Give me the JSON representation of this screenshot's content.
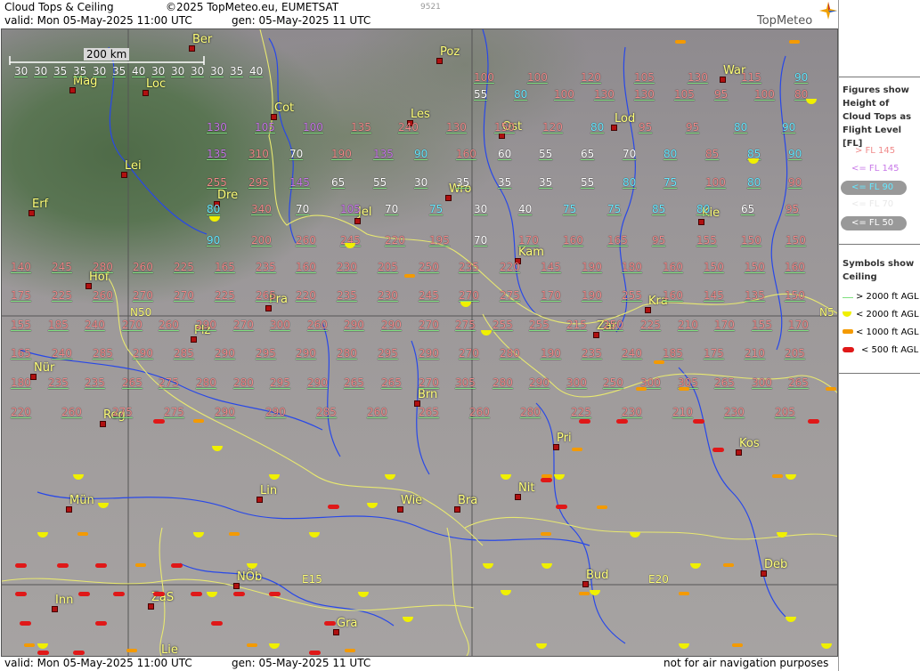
{
  "header": {
    "title": "Cloud Tops & Ceiling",
    "copyright": "©2025 TopMeteo.eu, EUMETSAT",
    "valid": "valid:  Mon  05-May-2025  11:00 UTC",
    "gen": "gen: 05-May-2025 11 UTC",
    "id": "9521",
    "logo": "TopMeteo"
  },
  "footer": {
    "valid": "valid:  Mon  05-May-2025  11:00 UTC",
    "gen": "gen: 05-May-2025 11 UTC",
    "disclaimer": "not for air navigation purposes"
  },
  "scale_label": "200 km",
  "legend": {
    "figures_title": "Figures show Height of Cloud Tops as Flight Level  [FL]",
    "fl_items": [
      {
        "text": "> FL 145",
        "color": "#f08a8a"
      },
      {
        "text": "<= FL 145",
        "color": "#c878e8"
      },
      {
        "text": "<= FL 90",
        "color": "#66e8ff"
      },
      {
        "text": "<= FL 70",
        "color": "#e8e8e8"
      },
      {
        "text": "<= FL 50",
        "color": "#ffffff"
      }
    ],
    "symbols_title": "Symbols show Ceiling",
    "symbol_items": [
      {
        "text": "> 2000 ft AGL",
        "symbol": "green-line"
      },
      {
        "text": "< 2000 ft AGL",
        "symbol": "yellow-half-circle"
      },
      {
        "text": "< 1000 ft AGL",
        "symbol": "orange-bar"
      },
      {
        "text": "< 500 ft AGL",
        "symbol": "red-bar"
      }
    ]
  },
  "grid_labels": [
    "N50",
    "N5",
    "E15",
    "E20"
  ],
  "cities": [
    {
      "name": "Ber"
    },
    {
      "name": "Poz"
    },
    {
      "name": "War"
    },
    {
      "name": "Mag"
    },
    {
      "name": "Loc"
    },
    {
      "name": "Cot"
    },
    {
      "name": "Les"
    },
    {
      "name": "Ost"
    },
    {
      "name": "Lod"
    },
    {
      "name": "Lei"
    },
    {
      "name": "Dre"
    },
    {
      "name": "Wro"
    },
    {
      "name": "Erf"
    },
    {
      "name": "Jel"
    },
    {
      "name": "Kie"
    },
    {
      "name": "Kam"
    },
    {
      "name": "Hof"
    },
    {
      "name": "Pra"
    },
    {
      "name": "Kra"
    },
    {
      "name": "Plz"
    },
    {
      "name": "Zar"
    },
    {
      "name": "Nür"
    },
    {
      "name": "Brn"
    },
    {
      "name": "Reg"
    },
    {
      "name": "Pri"
    },
    {
      "name": "Kos"
    },
    {
      "name": "Lin"
    },
    {
      "name": "Nit"
    },
    {
      "name": "Mün"
    },
    {
      "name": "Wie"
    },
    {
      "name": "Bra"
    },
    {
      "name": "Bud"
    },
    {
      "name": "Deb"
    },
    {
      "name": "NÖb"
    },
    {
      "name": "Inn"
    },
    {
      "name": "ZaS"
    },
    {
      "name": "Gra"
    },
    {
      "name": "Lie"
    }
  ],
  "colors": {
    "high": "#f08a8a",
    "mid": "#c878e8",
    "low90": "#66e8ff",
    "low70": "#e8e8e8",
    "low50": "#ffffff",
    "ceiling_ok": "#7fe07f",
    "ceiling_2000": "#f0f000",
    "ceiling_1000": "#f49a00",
    "ceiling_500": "#e01818",
    "city": "#ffff78",
    "country_border": "#e8e870",
    "river": "#2848e8"
  },
  "cloud_tops": [
    [
      "30",
      "w"
    ],
    [
      "30",
      "w"
    ],
    [
      "35",
      "w"
    ],
    [
      "35",
      "w"
    ],
    [
      "30",
      "w"
    ],
    [
      "35",
      "w"
    ],
    [
      "40",
      "w"
    ],
    [
      "30",
      "w"
    ],
    [
      "30",
      "w"
    ],
    [
      "30",
      "w"
    ],
    [
      "30",
      "w"
    ],
    [
      "35",
      "w"
    ],
    [
      "40",
      "w"
    ],
    [
      "100",
      "h"
    ],
    [
      "100",
      "h"
    ],
    [
      "120",
      "h"
    ],
    [
      "105",
      "h"
    ],
    [
      "130",
      "h"
    ],
    [
      "115",
      "h"
    ],
    [
      "90",
      "c"
    ],
    [
      "55",
      "w"
    ],
    [
      "80",
      "c"
    ],
    [
      "100",
      "h"
    ],
    [
      "130",
      "h"
    ],
    [
      "130",
      "h"
    ],
    [
      "105",
      "h"
    ],
    [
      "95",
      "h"
    ],
    [
      "100",
      "h"
    ],
    [
      "80",
      "h"
    ],
    [
      "130",
      "m"
    ],
    [
      "105",
      "m"
    ],
    [
      "100",
      "m"
    ],
    [
      "135",
      "h"
    ],
    [
      "240",
      "h"
    ],
    [
      "130",
      "h"
    ],
    [
      "150",
      "h"
    ],
    [
      "120",
      "h"
    ],
    [
      "80",
      "c"
    ],
    [
      "95",
      "h"
    ],
    [
      "95",
      "h"
    ],
    [
      "80",
      "c"
    ],
    [
      "90",
      "c"
    ],
    [
      "135",
      "m"
    ],
    [
      "310",
      "h"
    ],
    [
      "70",
      "w"
    ],
    [
      "190",
      "h"
    ],
    [
      "135",
      "m"
    ],
    [
      "90",
      "c"
    ],
    [
      "160",
      "h"
    ],
    [
      "60",
      "w"
    ],
    [
      "55",
      "w"
    ],
    [
      "65",
      "w"
    ],
    [
      "70",
      "w"
    ],
    [
      "80",
      "c"
    ],
    [
      "85",
      "h"
    ],
    [
      "85",
      "c"
    ],
    [
      "90",
      "c"
    ],
    [
      "255",
      "h"
    ],
    [
      "295",
      "h"
    ],
    [
      "145",
      "m"
    ],
    [
      "65",
      "w"
    ],
    [
      "55",
      "w"
    ],
    [
      "30",
      "w"
    ],
    [
      "35",
      "w"
    ],
    [
      "35",
      "w"
    ],
    [
      "35",
      "w"
    ],
    [
      "55",
      "w"
    ],
    [
      "80",
      "c"
    ],
    [
      "75",
      "c"
    ],
    [
      "100",
      "h"
    ],
    [
      "80",
      "c"
    ],
    [
      "90",
      "h"
    ],
    [
      "80",
      "c"
    ],
    [
      "340",
      "h"
    ],
    [
      "70",
      "w"
    ],
    [
      "105",
      "m"
    ],
    [
      "70",
      "w"
    ],
    [
      "75",
      "c"
    ],
    [
      "30",
      "w"
    ],
    [
      "40",
      "w"
    ],
    [
      "75",
      "c"
    ],
    [
      "75",
      "c"
    ],
    [
      "85",
      "c"
    ],
    [
      "80",
      "c"
    ],
    [
      "65",
      "w"
    ],
    [
      "95",
      "h"
    ],
    [
      "90",
      "c"
    ],
    [
      "200",
      "h"
    ],
    [
      "260",
      "h"
    ],
    [
      "245",
      "h"
    ],
    [
      "220",
      "h"
    ],
    [
      "195",
      "h"
    ],
    [
      "70",
      "w"
    ],
    [
      "170",
      "h"
    ],
    [
      "160",
      "h"
    ],
    [
      "165",
      "h"
    ],
    [
      "95",
      "h"
    ],
    [
      "155",
      "h"
    ],
    [
      "150",
      "h"
    ],
    [
      "150",
      "h"
    ],
    [
      "140",
      "h"
    ],
    [
      "245",
      "h"
    ],
    [
      "280",
      "h"
    ],
    [
      "260",
      "h"
    ],
    [
      "225",
      "h"
    ],
    [
      "165",
      "h"
    ],
    [
      "235",
      "h"
    ],
    [
      "160",
      "h"
    ],
    [
      "230",
      "h"
    ],
    [
      "205",
      "h"
    ],
    [
      "250",
      "h"
    ],
    [
      "235",
      "h"
    ],
    [
      "220",
      "h"
    ],
    [
      "145",
      "h"
    ],
    [
      "190",
      "h"
    ],
    [
      "180",
      "h"
    ],
    [
      "160",
      "h"
    ],
    [
      "150",
      "h"
    ],
    [
      "150",
      "h"
    ],
    [
      "160",
      "h"
    ],
    [
      "175",
      "h"
    ],
    [
      "225",
      "h"
    ],
    [
      "260",
      "h"
    ],
    [
      "270",
      "h"
    ],
    [
      "270",
      "h"
    ],
    [
      "225",
      "h"
    ],
    [
      "265",
      "h"
    ],
    [
      "220",
      "h"
    ],
    [
      "235",
      "h"
    ],
    [
      "230",
      "h"
    ],
    [
      "245",
      "h"
    ],
    [
      "270",
      "h"
    ],
    [
      "275",
      "h"
    ],
    [
      "170",
      "h"
    ],
    [
      "190",
      "h"
    ],
    [
      "255",
      "h"
    ],
    [
      "160",
      "h"
    ],
    [
      "145",
      "h"
    ],
    [
      "135",
      "h"
    ],
    [
      "150",
      "h"
    ],
    [
      "155",
      "h"
    ],
    [
      "185",
      "h"
    ],
    [
      "240",
      "h"
    ],
    [
      "270",
      "h"
    ],
    [
      "260",
      "h"
    ],
    [
      "290",
      "h"
    ],
    [
      "270",
      "h"
    ],
    [
      "300",
      "h"
    ],
    [
      "260",
      "h"
    ],
    [
      "290",
      "h"
    ],
    [
      "290",
      "h"
    ],
    [
      "270",
      "h"
    ],
    [
      "275",
      "h"
    ],
    [
      "255",
      "h"
    ],
    [
      "255",
      "h"
    ],
    [
      "215",
      "h"
    ],
    [
      "250",
      "h"
    ],
    [
      "225",
      "h"
    ],
    [
      "210",
      "h"
    ],
    [
      "170",
      "h"
    ],
    [
      "155",
      "h"
    ],
    [
      "170",
      "h"
    ],
    [
      "165",
      "h"
    ],
    [
      "240",
      "h"
    ],
    [
      "285",
      "h"
    ],
    [
      "290",
      "h"
    ],
    [
      "285",
      "h"
    ],
    [
      "290",
      "h"
    ],
    [
      "295",
      "h"
    ],
    [
      "290",
      "h"
    ],
    [
      "280",
      "h"
    ],
    [
      "295",
      "h"
    ],
    [
      "290",
      "h"
    ],
    [
      "270",
      "h"
    ],
    [
      "280",
      "h"
    ],
    [
      "190",
      "h"
    ],
    [
      "235",
      "h"
    ],
    [
      "240",
      "h"
    ],
    [
      "185",
      "h"
    ],
    [
      "175",
      "h"
    ],
    [
      "210",
      "h"
    ],
    [
      "205",
      "h"
    ],
    [
      "180",
      "h"
    ],
    [
      "235",
      "h"
    ],
    [
      "235",
      "h"
    ],
    [
      "265",
      "h"
    ],
    [
      "275",
      "h"
    ],
    [
      "280",
      "h"
    ],
    [
      "280",
      "h"
    ],
    [
      "295",
      "h"
    ],
    [
      "290",
      "h"
    ],
    [
      "265",
      "h"
    ],
    [
      "265",
      "h"
    ],
    [
      "270",
      "h"
    ],
    [
      "305",
      "h"
    ],
    [
      "280",
      "h"
    ],
    [
      "290",
      "h"
    ],
    [
      "300",
      "h"
    ],
    [
      "250",
      "h"
    ],
    [
      "300",
      "h"
    ],
    [
      "305",
      "h"
    ],
    [
      "265",
      "h"
    ],
    [
      "300",
      "h"
    ],
    [
      "265",
      "h"
    ],
    [
      "220",
      "h"
    ],
    [
      "260",
      "h"
    ],
    [
      "275",
      "h"
    ],
    [
      "275",
      "h"
    ],
    [
      "290",
      "h"
    ],
    [
      "290",
      "h"
    ],
    [
      "285",
      "h"
    ],
    [
      "260",
      "h"
    ],
    [
      "265",
      "h"
    ],
    [
      "260",
      "h"
    ],
    [
      "280",
      "h"
    ],
    [
      "225",
      "h"
    ],
    [
      "230",
      "h"
    ],
    [
      "210",
      "h"
    ],
    [
      "230",
      "h"
    ],
    [
      "205",
      "h"
    ],
    [
      "220",
      "h"
    ]
  ]
}
